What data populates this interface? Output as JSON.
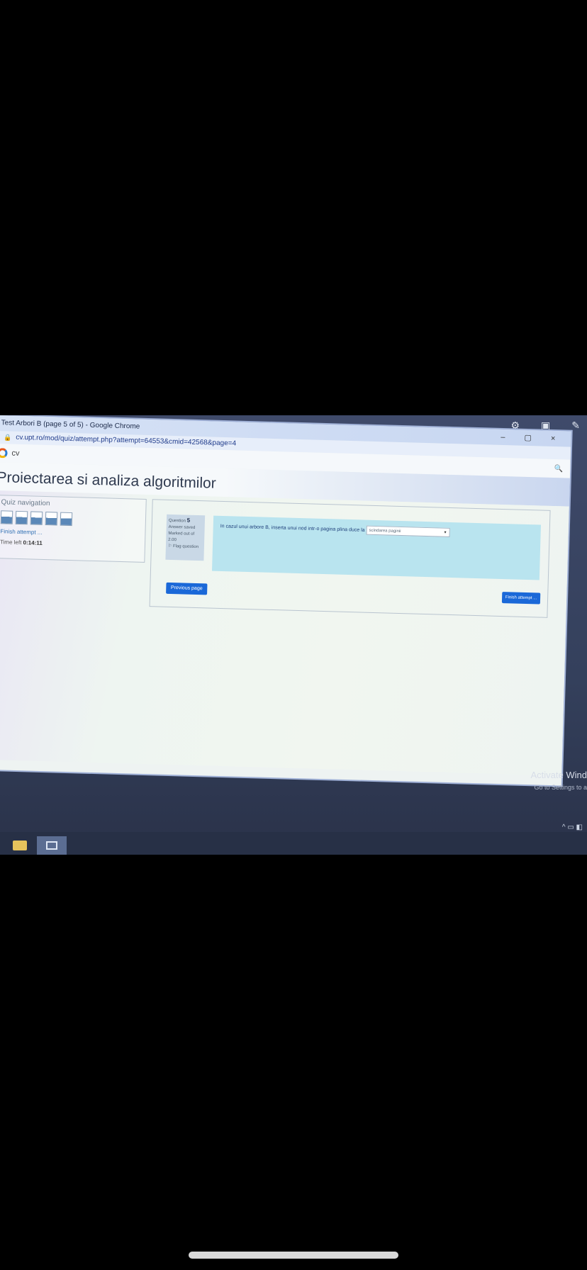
{
  "browser": {
    "title": "Test Arbori B (page 5 of 5) - Google Chrome",
    "url": "cv.upt.ro/mod/quiz/attempt.php?attempt=64553&cmid=42568&page=4",
    "window_controls": [
      "–",
      "▢",
      "×"
    ]
  },
  "site": {
    "logo_text": "cv",
    "course_title": "Proiectarea si analiza algoritmilor"
  },
  "quiz_nav": {
    "title": "Quiz navigation",
    "question_buttons": [
      "1",
      "2",
      "3",
      "4",
      "5"
    ],
    "finish_link": "Finish attempt ...",
    "time_left_label": "Time left",
    "time_left_value": "0:14:11"
  },
  "question": {
    "label": "Question",
    "number": "5",
    "status": "Answer saved",
    "marked": "Marked out of 2.00",
    "flag": "Flag question",
    "text": "In cazul unui arbore B, inserta unui nod intr-o pagina plina duce la",
    "selected_answer": "scindarea paginii"
  },
  "buttons": {
    "previous": "Previous page",
    "finish": "Finish attempt ..."
  },
  "os": {
    "activate_title": "Activate Wind",
    "activate_sub": "Go to Settings to a"
  },
  "colors": {
    "primary": "#1a68d8",
    "answer_box": "#b9e4ef"
  }
}
